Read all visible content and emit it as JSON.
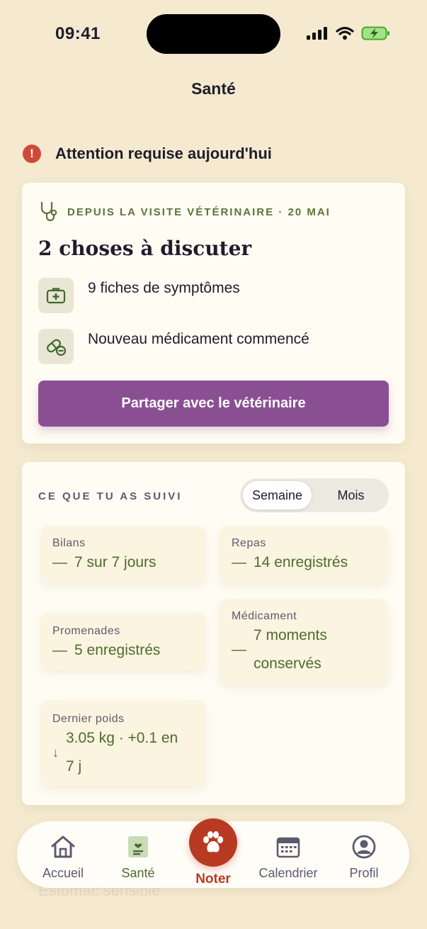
{
  "status_bar": {
    "time": "09:41"
  },
  "header": {
    "title": "Santé"
  },
  "alert": {
    "text": "Attention requise aujourd'hui",
    "icon": "alert-icon"
  },
  "vet_card": {
    "meta": "DEPUIS LA VISITE VÉTÉRINAIRE · 20 MAI",
    "heading": "2 choses à discuter",
    "items": [
      {
        "icon": "medical-kit-icon",
        "label": "9 fiches de symptômes"
      },
      {
        "icon": "pill-icon",
        "label": "Nouveau médicament commencé"
      }
    ],
    "share_label": "Partager avec le vétérinaire"
  },
  "tracking": {
    "title": "CE QUE TU AS SUIVI",
    "period_options": [
      "Semaine",
      "Mois"
    ],
    "selected_period": "Semaine",
    "stats": [
      {
        "label": "Bilans",
        "symbol": "—",
        "value": "7 sur 7 jours"
      },
      {
        "label": "Repas",
        "symbol": "—",
        "value": "14 enregistrés"
      },
      {
        "label": "Promenades",
        "symbol": "—",
        "value": "5 enregistrés"
      },
      {
        "label": "Médicament",
        "symbol": "—",
        "value": "7 moments conservés"
      },
      {
        "label": "Dernier poids",
        "symbol": "↓",
        "value": "3.05 kg · +0.1 en 7 j"
      }
    ]
  },
  "behind_tabbar_text": "Estomac sensible",
  "tab_bar": {
    "tabs": [
      {
        "label": "Accueil",
        "icon": "home-icon"
      },
      {
        "label": "Santé",
        "icon": "health-record-icon"
      },
      {
        "label": "Noter",
        "icon": "paw-icon"
      },
      {
        "label": "Calendrier",
        "icon": "calendar-icon"
      },
      {
        "label": "Profil",
        "icon": "profile-icon"
      }
    ],
    "active": "Santé"
  },
  "colors": {
    "background": "#f5ead0",
    "accent_green": "#4e6b2f",
    "button_purple": "#8a4f93",
    "noter_red": "#b83a22",
    "alert_red": "#cf4a36"
  }
}
